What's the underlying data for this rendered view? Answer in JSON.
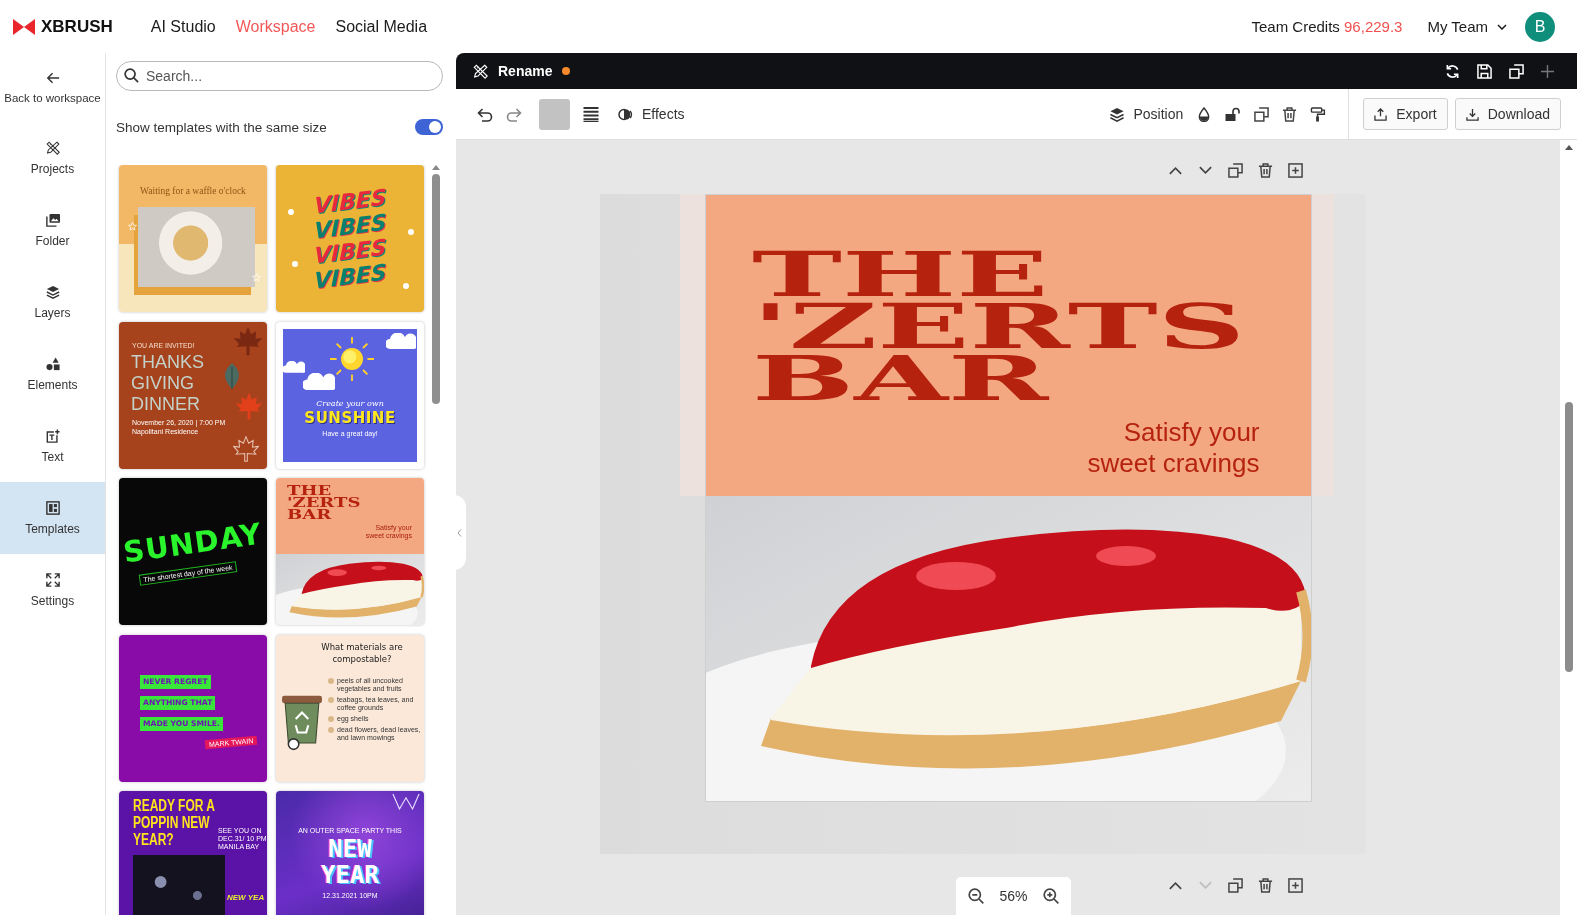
{
  "topbar": {
    "brand": "XBRUSH",
    "nav": [
      {
        "label": "AI Studio",
        "selected": false
      },
      {
        "label": "Workspace",
        "selected": true
      },
      {
        "label": "Social Media",
        "selected": false
      }
    ],
    "credits_label": "Team Credits",
    "credits_value": "96,229.3",
    "team": "My Team",
    "avatar": "B"
  },
  "sidebar": {
    "back_label": "Back to workspace",
    "items": [
      {
        "kind": "projects",
        "label": "Projects",
        "selected": false
      },
      {
        "kind": "folder",
        "label": "Folder",
        "selected": false
      },
      {
        "kind": "layers",
        "label": "Layers",
        "selected": false
      },
      {
        "kind": "elements",
        "label": "Elements",
        "selected": false
      },
      {
        "kind": "text",
        "label": "Text",
        "selected": false
      },
      {
        "kind": "templates",
        "label": "Templates",
        "selected": true
      },
      {
        "kind": "settings",
        "label": "Settings",
        "selected": false
      }
    ]
  },
  "panel": {
    "search_placeholder": "Search...",
    "same_size_label": "Show templates with the same size",
    "same_size_on": true,
    "templates": [
      {
        "kind": "waffle",
        "heading": "Waiting for a waffle o'clock"
      },
      {
        "kind": "vibes",
        "words": [
          "VIBES",
          "VIBES",
          "VIBES",
          "VIBES"
        ]
      },
      {
        "kind": "thanksgiving",
        "kicker": "YOU ARE INVITED!",
        "title_lines": [
          "THANKS",
          "GIVING",
          "DINNER"
        ],
        "details": [
          "November 26, 2020 | 7:00 PM",
          "Napolitani Residence"
        ]
      },
      {
        "kind": "sunshine",
        "script": "Create your own",
        "title": "SUNSHINE",
        "note": "Have a great day!"
      },
      {
        "kind": "sunday",
        "title": "SUNDAY",
        "subtitle": "The shortest day of the week"
      },
      {
        "kind": "zerts",
        "title_lines": [
          "THE",
          "'ZERTS",
          "BAR"
        ],
        "tagline_lines": [
          "Satisfy your",
          "sweet cravings"
        ]
      },
      {
        "kind": "quote",
        "lines": [
          "NEVER REGRET",
          "ANYTHING THAT",
          "MADE YOU SMILE."
        ],
        "author": "MARK TWAIN"
      },
      {
        "kind": "compost",
        "title_lines": [
          "What materials are",
          "compostable?"
        ],
        "items": [
          "peels of all uncooked vegetables and fruits",
          "teabags, tea leaves, and coffee grounds",
          "egg shells",
          "dead flowers, dead leaves, and lawn mowings"
        ]
      },
      {
        "kind": "party",
        "title_lines": [
          "READY FOR A",
          "POPPIN NEW",
          "YEAR?"
        ],
        "details": [
          "SEE YOU ON",
          "DEC.31/ 10 PM",
          "MANILA BAY"
        ],
        "corner": "NEW YEA"
      },
      {
        "kind": "space",
        "kicker": "AN OUTER SPACE PARTY THIS",
        "title_lines": [
          "NEW",
          "YEAR"
        ],
        "date": "12.31.2021 10PM"
      }
    ]
  },
  "editor": {
    "title": "Rename",
    "unsaved": true,
    "add_disabled": true,
    "toolbar": {
      "effects": "Effects",
      "position": "Position"
    },
    "actions": [
      {
        "kind": "export",
        "label": "Export"
      },
      {
        "kind": "download",
        "label": "Download"
      }
    ],
    "page_controls": [
      {
        "up_disabled": false,
        "down_disabled": false
      },
      {
        "up_disabled": false,
        "down_disabled": true
      }
    ],
    "zoom": "56%",
    "design": {
      "title_lines": [
        "THE",
        "'ZERTS",
        "BAR"
      ],
      "tagline_lines": [
        "Satisfy your",
        "sweet cravings"
      ]
    }
  }
}
